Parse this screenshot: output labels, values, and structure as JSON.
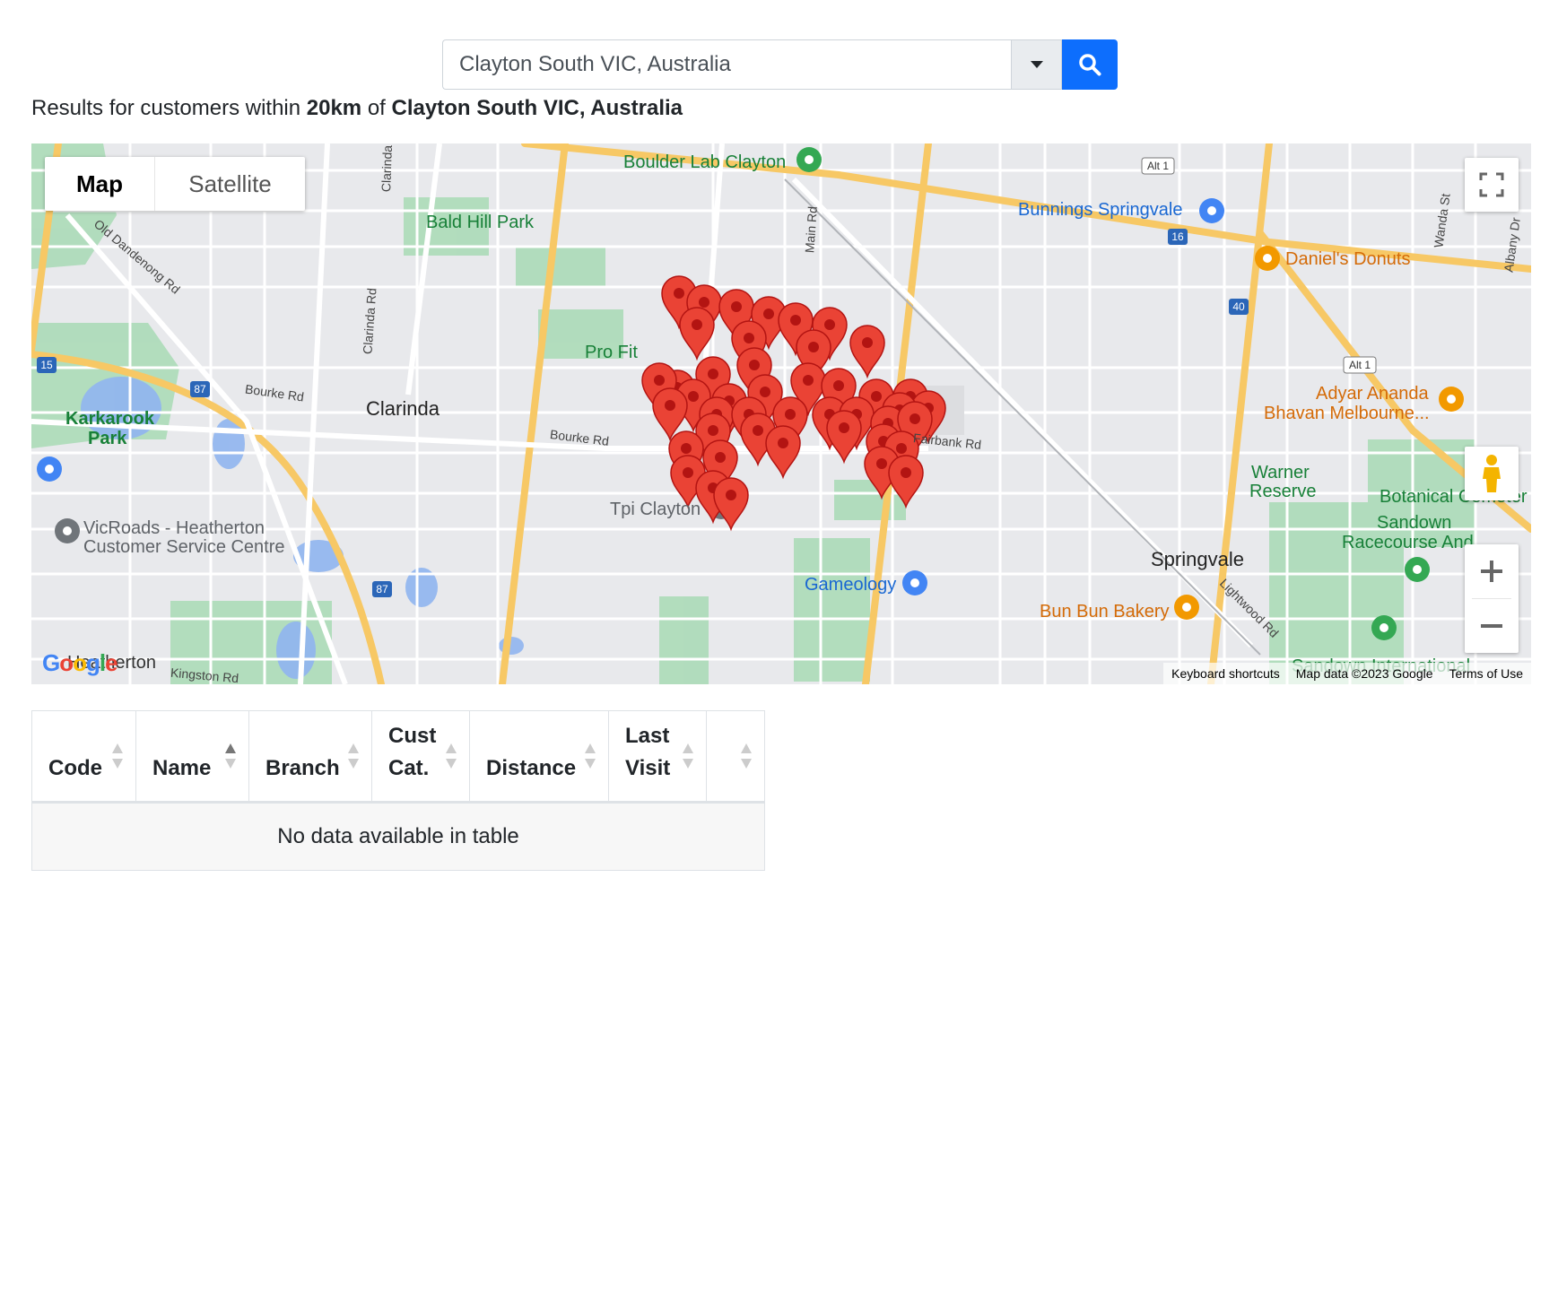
{
  "search": {
    "value": "Clayton South VIC, Australia"
  },
  "results": {
    "prefix": "Results for customers within ",
    "radius": "20km",
    "middle": " of ",
    "location": "Clayton South VIC, Australia"
  },
  "map": {
    "type_controls": {
      "map": "Map",
      "satellite": "Satellite"
    },
    "labels": {
      "boulder_lab": "Boulder Lab Clayton",
      "bald_hill_park": "Bald Hill Park",
      "bunnings": "Bunnings Springvale",
      "daniels_donuts": "Daniel's Donuts",
      "clarinda": "Clarinda",
      "karkarook_park_1": "Karkarook",
      "karkarook_park_2": "Park",
      "pro_fit": "Pro Fit",
      "adyar_1": "Adyar Ananda",
      "adyar_2": "Bhavan Melbourne...",
      "warner_1": "Warner",
      "warner_2": "Reserve",
      "botanical": "Botanical Cemeter",
      "sandown_1": "Sandown",
      "sandown_2": "Racecourse And",
      "springvale": "Springvale",
      "tpi_clayton": "Tpi Clayton",
      "vicroads_1": "VicRoads - Heatherton",
      "vicroads_2": "Customer Service Centre",
      "gameology": "Gameology",
      "bun_bun": "Bun Bun Bakery",
      "heatherton": "Heatherton",
      "sandown_intl": "Sandown International"
    },
    "roads": {
      "old_dandenong": "Old Dandenong Rd",
      "clarinda_rd_1": "Clarinda",
      "clarinda_rd_2": "Clarinda Rd",
      "bourke_rd_1": "Bourke Rd",
      "bourke_rd_2": "Bourke Rd",
      "main_rd": "Main Rd",
      "fairbank_rd": "Fairbank Rd",
      "wanda_st": "Wanda St",
      "albany_dr": "Albany Dr",
      "lightwood_rd": "Lightwood Rd",
      "kingston_rd": "Kingston Rd"
    },
    "shields": {
      "alt1a": "Alt 1",
      "alt1b": "Alt 1",
      "r16": "16",
      "r40": "40",
      "r15": "15",
      "r87a": "87",
      "r87b": "87"
    },
    "google_logo": "Google",
    "attribution": {
      "shortcuts": "Keyboard shortcuts",
      "data": "Map data ©2023 Google",
      "terms": "Terms of Use"
    },
    "marker_color": "#ea4335"
  },
  "table": {
    "headers": [
      {
        "line1": "",
        "line2": "Code"
      },
      {
        "line1": "",
        "line2": "Name"
      },
      {
        "line1": "",
        "line2": "Branch"
      },
      {
        "line1": "Cust",
        "line2": "Cat."
      },
      {
        "line1": "",
        "line2": "Distance"
      },
      {
        "line1": "Last",
        "line2": "Visit"
      },
      {
        "line1": "",
        "line2": ""
      }
    ],
    "empty_message": "No data available in table"
  }
}
